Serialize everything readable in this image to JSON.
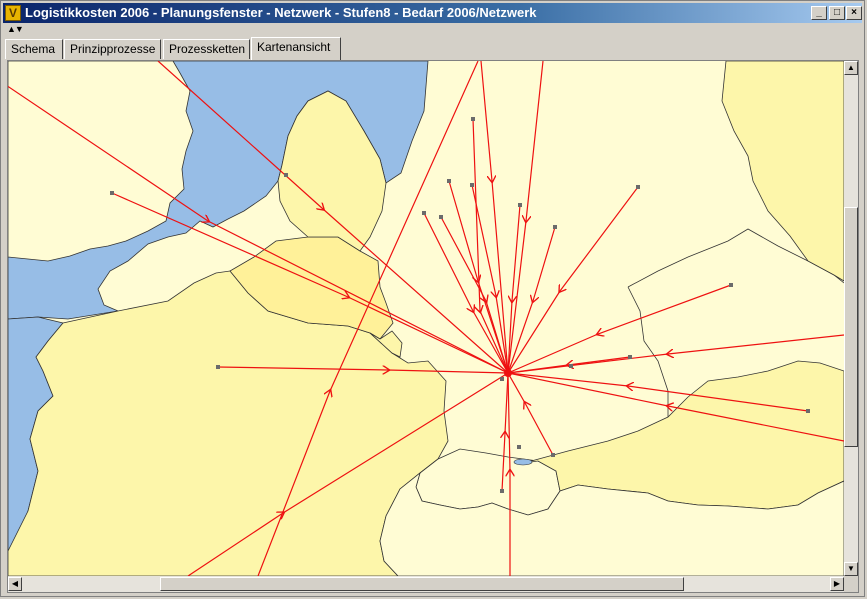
{
  "window": {
    "title": "Logistikkosten 2006 - Planungsfenster - Netzwerk - Stufen8 - Bedarf 2006/Netzwerk",
    "icon": "app-logo-icon",
    "buttons": {
      "minimize": "_",
      "maximize": "□",
      "close": "×"
    }
  },
  "toolbar": {
    "collapse_icon": "▲▼"
  },
  "tabs": [
    {
      "label": "Schema",
      "active": false
    },
    {
      "label": "Prinzipprozesse",
      "active": false
    },
    {
      "label": "Prozessketten",
      "active": false
    },
    {
      "label": "Kartenansicht",
      "active": true
    }
  ],
  "map": {
    "colors": {
      "sea": "#97bde6",
      "land_light": "#fffcd4",
      "land_yellow": "#fdf6aa",
      "land_bright": "#fff199",
      "route": "#ee1111",
      "node": "#6b6b6b",
      "border": "#333333"
    },
    "hub": "central-hub",
    "routes": [
      "route-01",
      "route-02",
      "route-03",
      "route-04",
      "route-05",
      "route-06",
      "route-07",
      "route-08",
      "route-09",
      "route-10",
      "route-11",
      "route-12",
      "route-13",
      "route-14",
      "route-15",
      "route-16",
      "route-17",
      "route-18",
      "route-19",
      "route-20",
      "route-21",
      "route-22",
      "route-23",
      "route-24"
    ]
  },
  "scrollbars": {
    "up_icon": "▲",
    "down_icon": "▼",
    "left_icon": "◀",
    "right_icon": "▶"
  }
}
